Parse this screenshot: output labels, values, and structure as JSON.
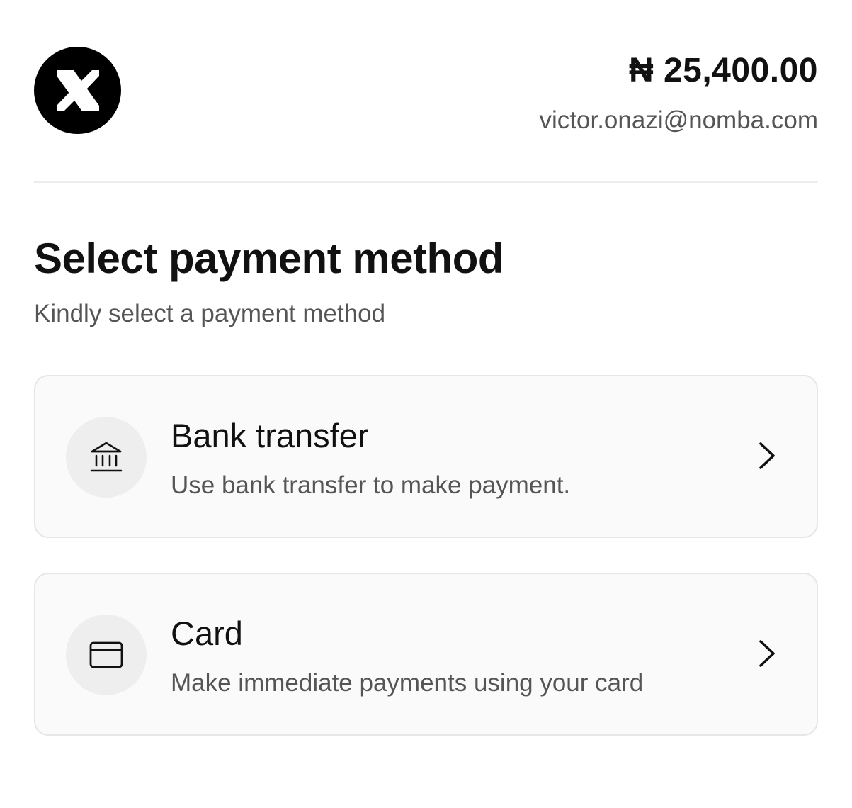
{
  "header": {
    "logo": "nomba-logo",
    "amount": "₦ 25,400.00",
    "email": "victor.onazi@nomba.com"
  },
  "main": {
    "title": "Select payment method",
    "subtitle": "Kindly select a payment method",
    "options": [
      {
        "label": "Bank transfer",
        "description": "Use bank transfer to make payment.",
        "icon": "bank-icon"
      },
      {
        "label": "Card",
        "description": "Make immediate payments using your card",
        "icon": "credit-card-icon"
      }
    ]
  },
  "colors": {
    "text_primary": "#111111",
    "text_secondary": "#555555",
    "card_background": "#fafafa",
    "card_border": "#e6e6e6",
    "icon_circle": "#eeeeee",
    "logo_background": "#000000"
  }
}
